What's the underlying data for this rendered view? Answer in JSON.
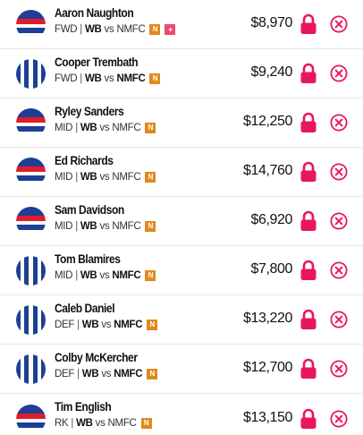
{
  "colors": {
    "accent": "#e8175d",
    "badge_n": "#e08a1e",
    "badge_plus": "#f0486a"
  },
  "players": [
    {
      "name": "Aaron Naughton",
      "pos": "FWD",
      "team": "WB",
      "vs": "vs",
      "opp": "NMFC",
      "bold_team": true,
      "badges": [
        "N",
        "+"
      ],
      "price": "$8,970",
      "guernsey": "hoops"
    },
    {
      "name": "Cooper Trembath",
      "pos": "FWD",
      "team": "WB",
      "vs": "vs",
      "opp": "NMFC",
      "bold_team": false,
      "badges": [
        "N"
      ],
      "price": "$9,240",
      "guernsey": "stripes"
    },
    {
      "name": "Ryley Sanders",
      "pos": "MID",
      "team": "WB",
      "vs": "vs",
      "opp": "NMFC",
      "bold_team": true,
      "badges": [
        "N"
      ],
      "price": "$12,250",
      "guernsey": "hoops"
    },
    {
      "name": "Ed Richards",
      "pos": "MID",
      "team": "WB",
      "vs": "vs",
      "opp": "NMFC",
      "bold_team": true,
      "badges": [
        "N"
      ],
      "price": "$14,760",
      "guernsey": "hoops"
    },
    {
      "name": "Sam Davidson",
      "pos": "MID",
      "team": "WB",
      "vs": "vs",
      "opp": "NMFC",
      "bold_team": true,
      "badges": [
        "N"
      ],
      "price": "$6,920",
      "guernsey": "hoops"
    },
    {
      "name": "Tom Blamires",
      "pos": "MID",
      "team": "WB",
      "vs": "vs",
      "opp": "NMFC",
      "bold_team": false,
      "badges": [
        "N"
      ],
      "price": "$7,800",
      "guernsey": "stripes"
    },
    {
      "name": "Caleb Daniel",
      "pos": "DEF",
      "team": "WB",
      "vs": "vs",
      "opp": "NMFC",
      "bold_team": false,
      "badges": [
        "N"
      ],
      "price": "$13,220",
      "guernsey": "stripes"
    },
    {
      "name": "Colby McKercher",
      "pos": "DEF",
      "team": "WB",
      "vs": "vs",
      "opp": "NMFC",
      "bold_team": false,
      "badges": [
        "N"
      ],
      "price": "$12,700",
      "guernsey": "stripes"
    },
    {
      "name": "Tim English",
      "pos": "RK",
      "team": "WB",
      "vs": "vs",
      "opp": "NMFC",
      "bold_team": true,
      "badges": [
        "N"
      ],
      "price": "$13,150",
      "guernsey": "hoops"
    }
  ],
  "icons": {
    "lock": "lock-icon",
    "remove": "remove-x-icon",
    "guernsey": "guernsey-icon"
  }
}
